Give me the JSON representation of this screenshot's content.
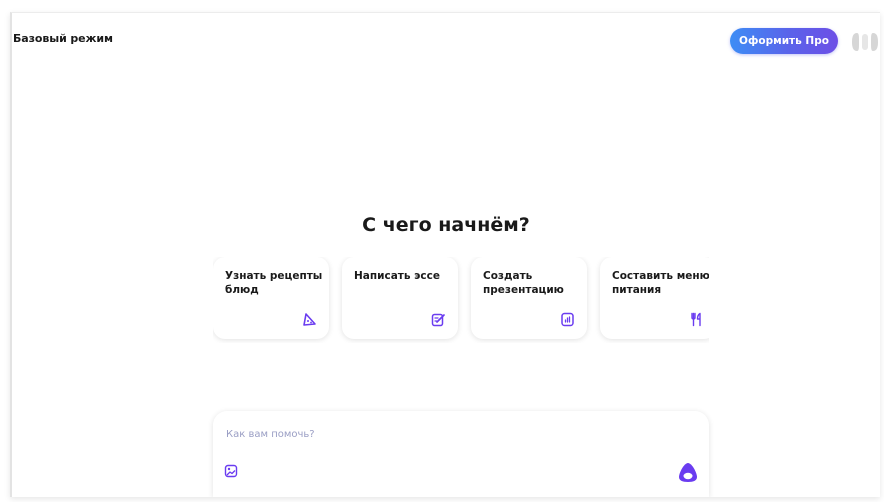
{
  "header": {
    "mode_label": "Базовый режим",
    "pro_button_label": "Оформить Про"
  },
  "main": {
    "headline": "С чего начнём?",
    "suggestions": [
      {
        "label": "Узнать рецепты\nблюд",
        "icon": "pizza-slice-icon"
      },
      {
        "label": "Написать эссе",
        "icon": "edit-note-icon"
      },
      {
        "label": "Создать\nпрезентацию",
        "icon": "presentation-chart-icon"
      },
      {
        "label": "Составить меню\nпитания",
        "icon": "fork-knife-icon"
      }
    ]
  },
  "prompt": {
    "placeholder": "Как вам помочь?",
    "attach_icon": "image-attach-icon",
    "send_icon": "alice-ring-icon"
  },
  "colors": {
    "accent": "#6a3cf0",
    "pro_gradient_start": "#3d8df5",
    "pro_gradient_end": "#6d4fe6"
  }
}
